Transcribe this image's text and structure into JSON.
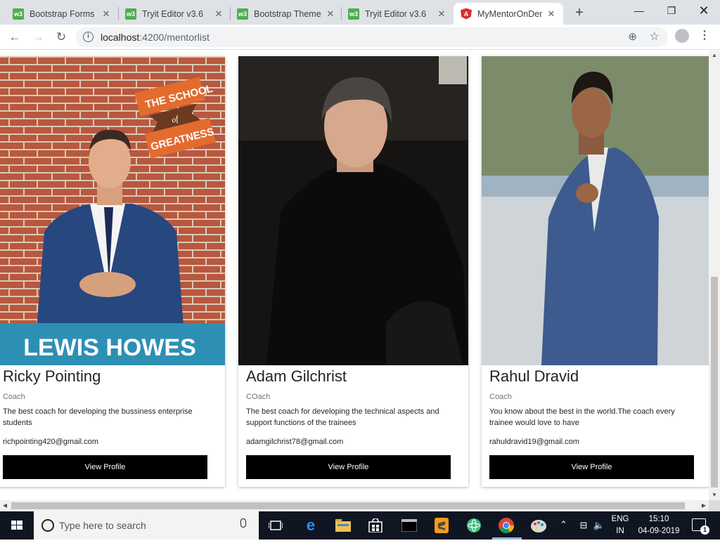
{
  "browser": {
    "tabs": [
      {
        "label": "Bootstrap Forms",
        "favicon": "w3-icon"
      },
      {
        "label": "Tryit Editor v3.6",
        "favicon": "w3-icon"
      },
      {
        "label": "Bootstrap Theme",
        "favicon": "w3-icon"
      },
      {
        "label": "Tryit Editor v3.6",
        "favicon": "w3-icon"
      },
      {
        "label": "MyMentorOnDem",
        "favicon": "angular-icon",
        "active": true
      }
    ],
    "url_host": "localhost",
    "url_rest": ":4200/mentorlist"
  },
  "mentors": [
    {
      "name": "Ricky Pointing",
      "role": "Coach",
      "description": "The best coach for developing the bussiness enterprise students",
      "email": "richpointing420@gmail.com",
      "button": "View Profile",
      "photo_banner_top": "THE SCHOOL",
      "photo_banner_mid": "of",
      "photo_banner_bottom": "GREATNESS",
      "photo_caption": "LEWIS HOWES"
    },
    {
      "name": "Adam Gilchrist",
      "role": "COach",
      "description": "The best coach for developing the technical aspects and support functions of the trainees",
      "email": "adamgilchrist78@gmail.com",
      "button": "View Profile"
    },
    {
      "name": "Rahul Dravid",
      "role": "Coach",
      "description": "You know about the best in the world.The coach every trainee would love to have",
      "email": "rahuldravid19@gmail.com",
      "button": "View Profile"
    }
  ],
  "taskbar": {
    "search_placeholder": "Type here to search",
    "lang_top": "ENG",
    "lang_bottom": "IN",
    "time": "15:10",
    "date": "04-09-2019",
    "notification_count": "1"
  },
  "colors": {
    "button_bg": "#000000",
    "taskbar_bg": "#101522",
    "tab_strip": "#dee1e6"
  }
}
